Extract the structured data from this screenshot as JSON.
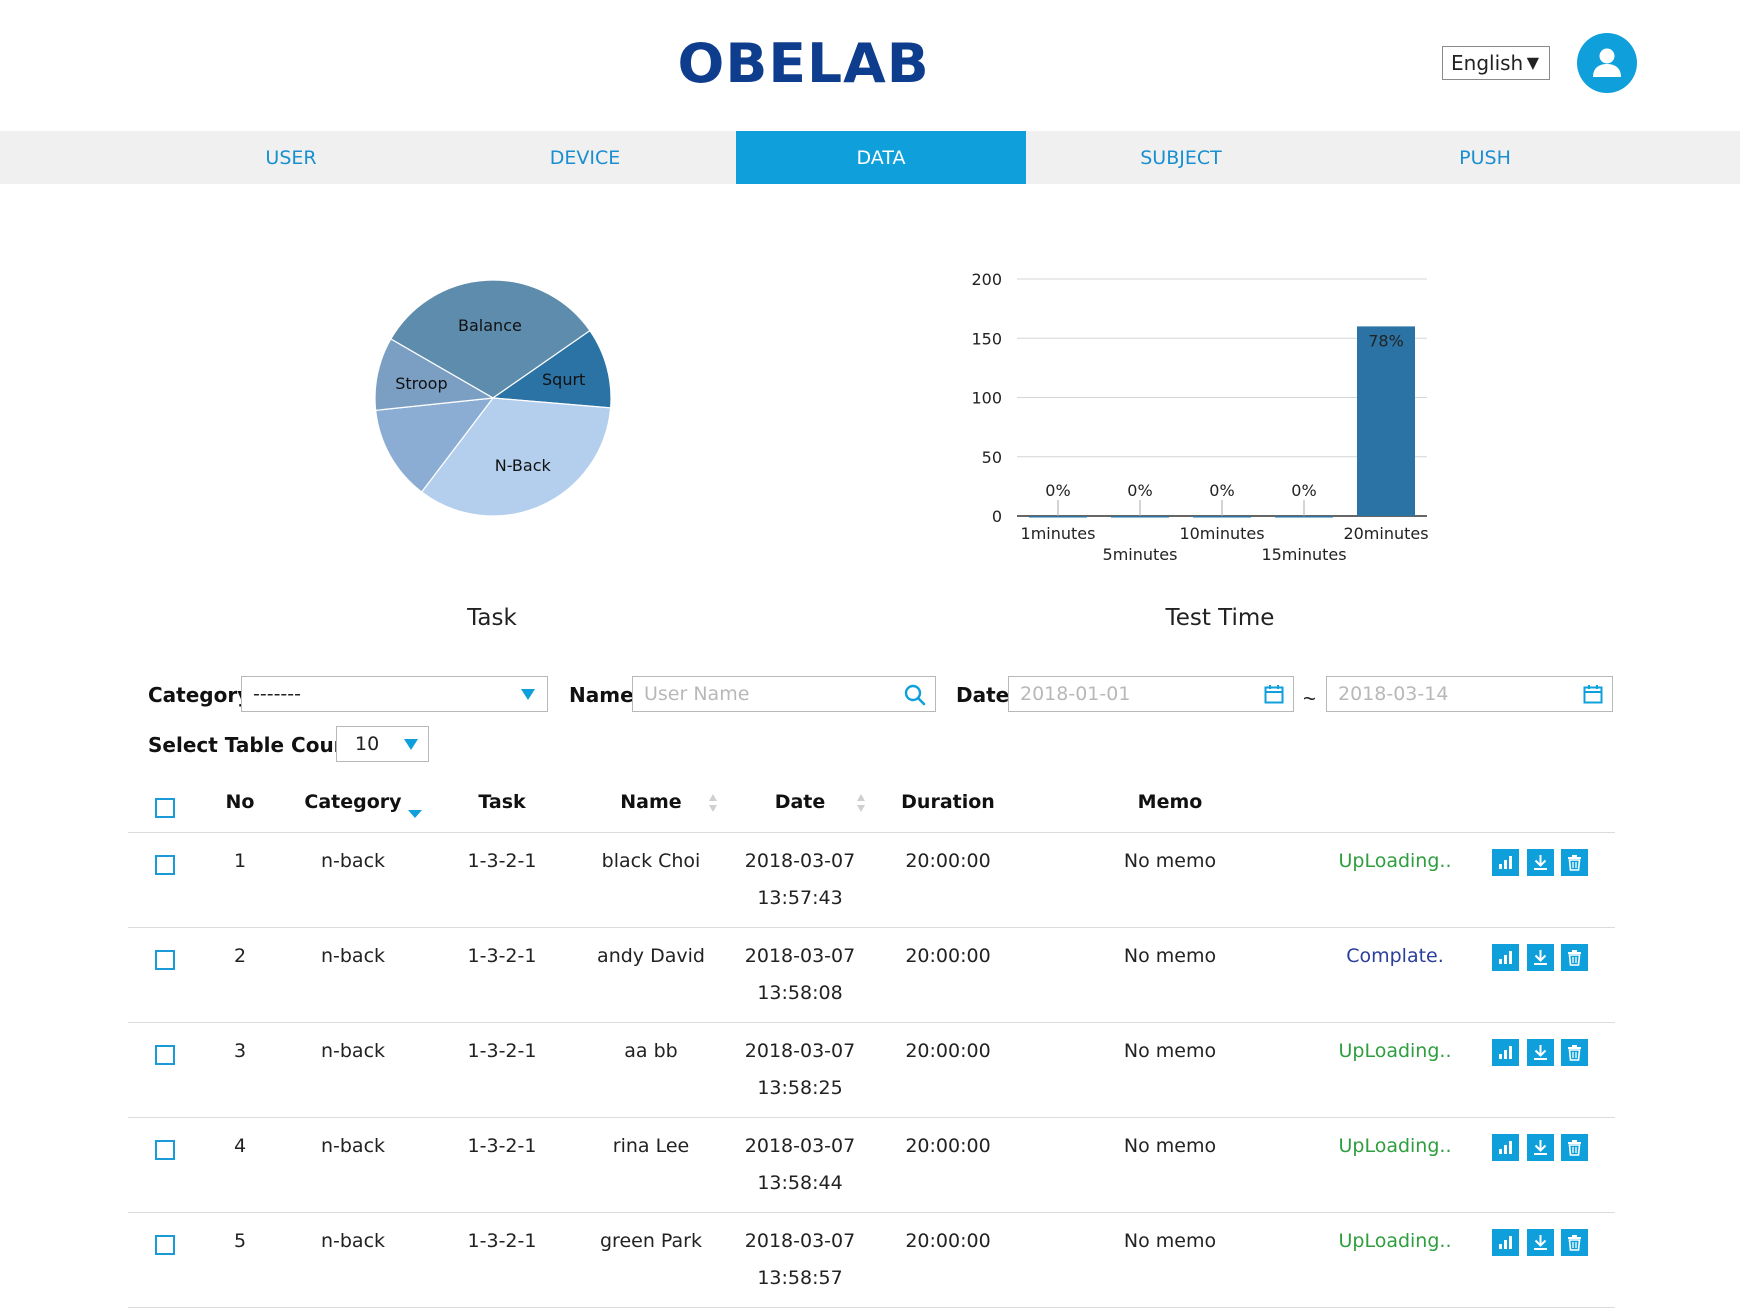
{
  "header": {
    "logo": "OBELAB",
    "language": "English"
  },
  "nav": {
    "tabs": [
      {
        "label": "USER",
        "active": false
      },
      {
        "label": "DEVICE",
        "active": false
      },
      {
        "label": "DATA",
        "active": true
      },
      {
        "label": "SUBJECT",
        "active": false
      },
      {
        "label": "PUSH",
        "active": false
      }
    ]
  },
  "colors": {
    "accent": "#0fa0dc",
    "nav_text": "#1a8fd0",
    "uploading": "#2e9e3e",
    "complete": "#2b3e9c",
    "logo": "#0e3d8e"
  },
  "chart_data": [
    {
      "type": "pie",
      "title": "Task",
      "slices": [
        {
          "label": "Balance",
          "value": 32,
          "color": "#5e8cad"
        },
        {
          "label": "Squrt",
          "value": 11,
          "color": "#2c73a5"
        },
        {
          "label": "N-Back",
          "value": 34,
          "color": "#b3cfed"
        },
        {
          "label": "",
          "value": 13,
          "color": "#8cadd3"
        },
        {
          "label": "Stroop",
          "value": 10,
          "color": "#7b9fc3"
        }
      ]
    },
    {
      "type": "bar",
      "title": "Test Time",
      "categories": [
        "1minutes",
        "5minutes",
        "10minutes",
        "15minutes",
        "20minutes"
      ],
      "values": [
        0,
        0,
        0,
        0,
        160
      ],
      "data_labels": [
        "0%",
        "0%",
        "0%",
        "0%",
        "78%"
      ],
      "yticks": [
        0,
        50,
        100,
        150,
        200
      ],
      "ylim": [
        0,
        200
      ],
      "grid": true,
      "color": "#2c73a5"
    }
  ],
  "filters": {
    "category_label": "Category",
    "category_value": "-------",
    "name_label": "Name",
    "name_placeholder": "User Name",
    "date_label": "Date",
    "date_from_placeholder": "2018-01-01",
    "date_separator": "~",
    "date_to_placeholder": "2018-03-14",
    "table_count_label": "Select Table Count",
    "table_count_value": "10"
  },
  "table": {
    "headers": {
      "no": "No",
      "category": "Category",
      "task": "Task",
      "name": "Name",
      "date": "Date",
      "duration": "Duration",
      "memo": "Memo"
    },
    "rows": [
      {
        "no": "1",
        "category": "n-back",
        "task": "1-3-2-1",
        "name": "black Choi",
        "date": "2018-03-07",
        "time": "13:57:43",
        "duration": "20:00:00",
        "memo": "No memo",
        "status": "UpLoading..",
        "status_type": "uploading"
      },
      {
        "no": "2",
        "category": "n-back",
        "task": "1-3-2-1",
        "name": "andy David",
        "date": "2018-03-07",
        "time": "13:58:08",
        "duration": "20:00:00",
        "memo": "No memo",
        "status": "Complate.",
        "status_type": "complete"
      },
      {
        "no": "3",
        "category": "n-back",
        "task": "1-3-2-1",
        "name": "aa bb",
        "date": "2018-03-07",
        "time": "13:58:25",
        "duration": "20:00:00",
        "memo": "No memo",
        "status": "UpLoading..",
        "status_type": "uploading"
      },
      {
        "no": "4",
        "category": "n-back",
        "task": "1-3-2-1",
        "name": "rina Lee",
        "date": "2018-03-07",
        "time": "13:58:44",
        "duration": "20:00:00",
        "memo": "No memo",
        "status": "UpLoading..",
        "status_type": "uploading"
      },
      {
        "no": "5",
        "category": "n-back",
        "task": "1-3-2-1",
        "name": "green Park",
        "date": "2018-03-07",
        "time": "13:58:57",
        "duration": "20:00:00",
        "memo": "No memo",
        "status": "UpLoading..",
        "status_type": "uploading"
      }
    ],
    "row_actions": [
      "chart-icon",
      "download-icon",
      "trash-icon"
    ]
  }
}
